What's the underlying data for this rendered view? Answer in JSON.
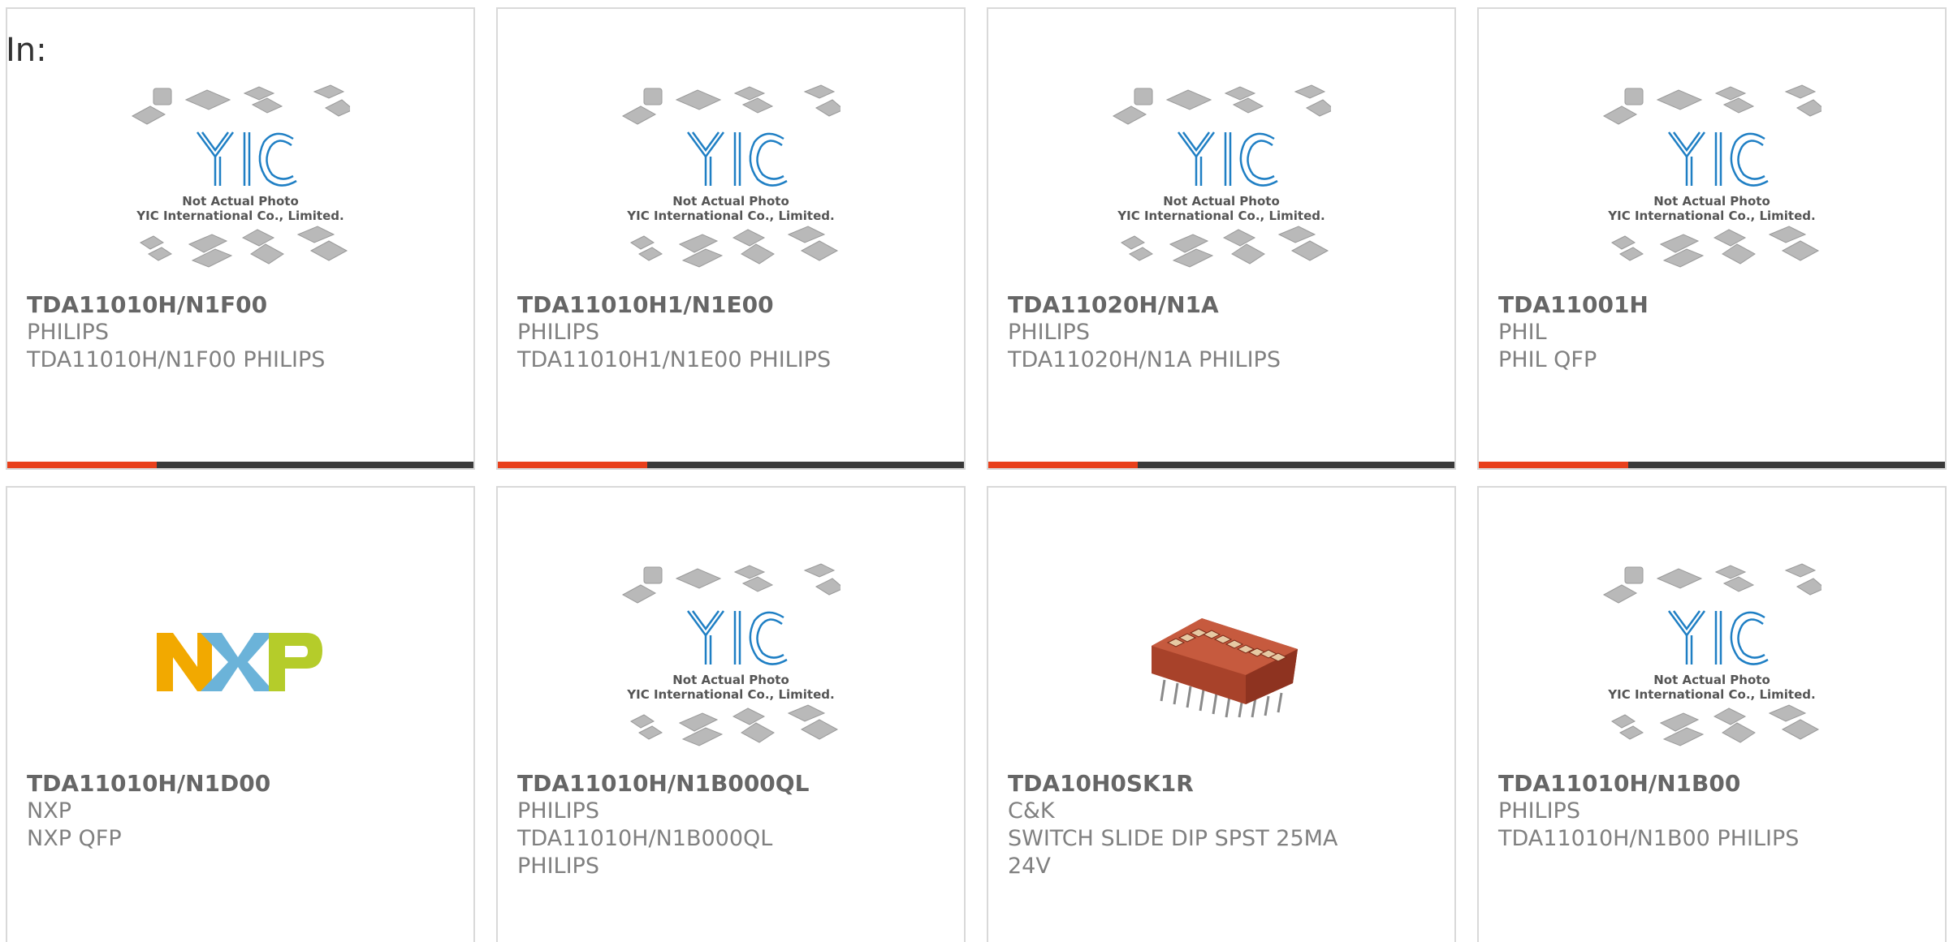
{
  "header": {
    "label": "In:"
  },
  "placeholder": {
    "logo_text": "YIC",
    "line1": "Not Actual Photo",
    "line2": "YIC International Co., Limited."
  },
  "nxp_logo": {
    "text": "NXP"
  },
  "products": [
    {
      "part": "TDA11010H/N1F00",
      "brand": "PHILIPS",
      "desc": "TDA11010H/N1F00 PHILIPS",
      "image": "placeholder"
    },
    {
      "part": "TDA11010H1/N1E00",
      "brand": "PHILIPS",
      "desc": "TDA11010H1/N1E00 PHILIPS",
      "image": "placeholder"
    },
    {
      "part": "TDA11020H/N1A",
      "brand": "PHILIPS",
      "desc": "TDA11020H/N1A PHILIPS",
      "image": "placeholder"
    },
    {
      "part": "TDA11001H",
      "brand": "PHIL",
      "desc": "PHIL QFP",
      "image": "placeholder"
    },
    {
      "part": "TDA11010H/N1D00",
      "brand": "NXP",
      "desc": "NXP QFP",
      "image": "nxp-logo"
    },
    {
      "part": "TDA11010H/N1B000QL",
      "brand": "PHILIPS",
      "desc": "TDA11010H/N1B000QL PHILIPS",
      "image": "placeholder"
    },
    {
      "part": "TDA10H0SK1R",
      "brand": "C&K",
      "desc": "SWITCH SLIDE DIP SPST 25MA 24V",
      "image": "dip-switch"
    },
    {
      "part": "TDA11010H/N1B00",
      "brand": "PHILIPS",
      "desc": "TDA11010H/N1B00 PHILIPS",
      "image": "placeholder"
    }
  ],
  "colors": {
    "accent": "#e8401c",
    "bar": "#3a3a3a",
    "yic_blue": "#1f7fc4",
    "nxp_yellow": "#f2a900",
    "nxp_blue": "#6bb3d9",
    "nxp_green": "#b5cc2a"
  }
}
